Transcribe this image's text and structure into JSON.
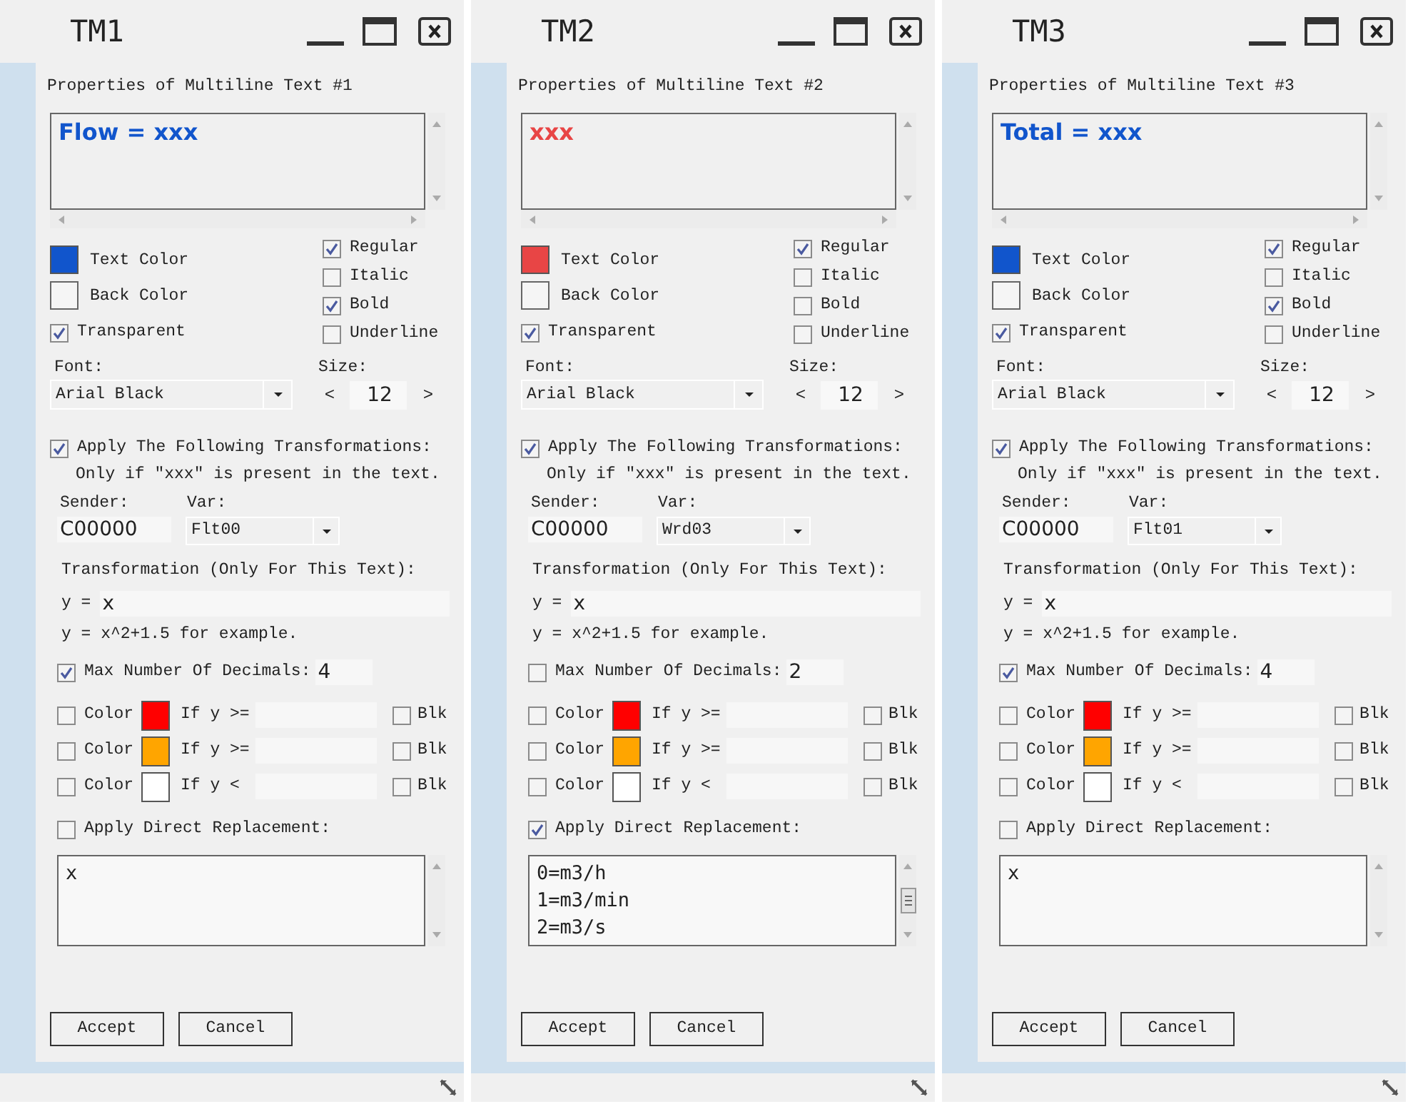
{
  "windows": [
    {
      "title": "TM1",
      "heading": "Properties of Multiline Text #1",
      "preview_text": "Flow = xxx",
      "text_color": {
        "label": "Text Color",
        "color": "#1155cc"
      },
      "back_color": {
        "label": "Back Color",
        "color": "#f5f5f5"
      },
      "transparent": {
        "label": "Transparent",
        "checked": true
      },
      "styles": [
        {
          "label": "Regular",
          "checked": true
        },
        {
          "label": "Italic",
          "checked": false
        },
        {
          "label": "Bold",
          "checked": true
        },
        {
          "label": "Underline",
          "checked": false
        }
      ],
      "font_label": "Font:",
      "font": "Arial Black",
      "size_label": "Size:",
      "size_prev": "<",
      "size": "12",
      "size_next": ">",
      "transform": {
        "label": "Apply The Following Transformations:",
        "checked": true
      },
      "only_if": "Only if \"xxx\" is present in the text.",
      "sender_label": "Sender:",
      "sender": "C00000",
      "var_label": "Var:",
      "var": "Flt00",
      "transformation_label": "Transformation (Only For This Text):",
      "y_label": "y =",
      "formula": "x",
      "example": "y = x^2+1.5 for example.",
      "max_decimals": {
        "label": "Max Number Of Decimals:",
        "checked": true,
        "value": "4"
      },
      "color_rules": [
        {
          "label": "Color",
          "checked": false,
          "color": "#ff0000",
          "condition": "If y >=",
          "blink_label": "Blk",
          "blink": false
        },
        {
          "label": "Color",
          "checked": false,
          "color": "#ffa500",
          "condition": "If y >=",
          "blink_label": "Blk",
          "blink": false
        },
        {
          "label": "Color",
          "checked": false,
          "color": "#ffffff",
          "condition": "If y <",
          "blink_label": "Blk",
          "blink": false
        }
      ],
      "replacement": {
        "label": "Apply Direct Replacement:",
        "checked": false,
        "lines": [
          "x"
        ]
      },
      "buttons": [
        "Accept",
        "Cancel"
      ]
    },
    {
      "title": "TM2",
      "heading": "Properties of Multiline Text #2",
      "preview_text": "xxx",
      "text_color": {
        "label": "Text Color",
        "color": "#e84545"
      },
      "back_color": {
        "label": "Back Color",
        "color": "#f5f5f5"
      },
      "transparent": {
        "label": "Transparent",
        "checked": true
      },
      "styles": [
        {
          "label": "Regular",
          "checked": true
        },
        {
          "label": "Italic",
          "checked": false
        },
        {
          "label": "Bold",
          "checked": false
        },
        {
          "label": "Underline",
          "checked": false
        }
      ],
      "font_label": "Font:",
      "font": "Arial Black",
      "size_label": "Size:",
      "size_prev": "<",
      "size": "12",
      "size_next": ">",
      "transform": {
        "label": "Apply The Following Transformations:",
        "checked": true
      },
      "only_if": "Only if \"xxx\" is present in the text.",
      "sender_label": "Sender:",
      "sender": "C00000",
      "var_label": "Var:",
      "var": "Wrd03",
      "transformation_label": "Transformation (Only For This Text):",
      "y_label": "y =",
      "formula": "x",
      "example": "y = x^2+1.5 for example.",
      "max_decimals": {
        "label": "Max Number Of Decimals:",
        "checked": false,
        "value": "2"
      },
      "color_rules": [
        {
          "label": "Color",
          "checked": false,
          "color": "#ff0000",
          "condition": "If y >=",
          "blink_label": "Blk",
          "blink": false
        },
        {
          "label": "Color",
          "checked": false,
          "color": "#ffa500",
          "condition": "If y >=",
          "blink_label": "Blk",
          "blink": false
        },
        {
          "label": "Color",
          "checked": false,
          "color": "#ffffff",
          "condition": "If y <",
          "blink_label": "Blk",
          "blink": false
        }
      ],
      "replacement": {
        "label": "Apply Direct Replacement:",
        "checked": true,
        "lines": [
          "0=m3/h",
          "1=m3/min",
          "2=m3/s"
        ]
      },
      "buttons": [
        "Accept",
        "Cancel"
      ]
    },
    {
      "title": "TM3",
      "heading": "Properties of Multiline Text #3",
      "preview_text": "Total = xxx",
      "text_color": {
        "label": "Text Color",
        "color": "#1155cc"
      },
      "back_color": {
        "label": "Back Color",
        "color": "#f5f5f5"
      },
      "transparent": {
        "label": "Transparent",
        "checked": true
      },
      "styles": [
        {
          "label": "Regular",
          "checked": true
        },
        {
          "label": "Italic",
          "checked": false
        },
        {
          "label": "Bold",
          "checked": true
        },
        {
          "label": "Underline",
          "checked": false
        }
      ],
      "font_label": "Font:",
      "font": "Arial Black",
      "size_label": "Size:",
      "size_prev": "<",
      "size": "12",
      "size_next": ">",
      "transform": {
        "label": "Apply The Following Transformations:",
        "checked": true
      },
      "only_if": "Only if \"xxx\" is present in the text.",
      "sender_label": "Sender:",
      "sender": "C00000",
      "var_label": "Var:",
      "var": "Flt01",
      "transformation_label": "Transformation (Only For This Text):",
      "y_label": "y =",
      "formula": "x",
      "example": "y = x^2+1.5 for example.",
      "max_decimals": {
        "label": "Max Number Of Decimals:",
        "checked": true,
        "value": "4"
      },
      "color_rules": [
        {
          "label": "Color",
          "checked": false,
          "color": "#ff0000",
          "condition": "If y >=",
          "blink_label": "Blk",
          "blink": false
        },
        {
          "label": "Color",
          "checked": false,
          "color": "#ffa500",
          "condition": "If y >=",
          "blink_label": "Blk",
          "blink": false
        },
        {
          "label": "Color",
          "checked": false,
          "color": "#ffffff",
          "condition": "If y <",
          "blink_label": "Blk",
          "blink": false
        }
      ],
      "replacement": {
        "label": "Apply Direct Replacement:",
        "checked": false,
        "lines": [
          "x"
        ]
      },
      "buttons": [
        "Accept",
        "Cancel"
      ]
    }
  ]
}
